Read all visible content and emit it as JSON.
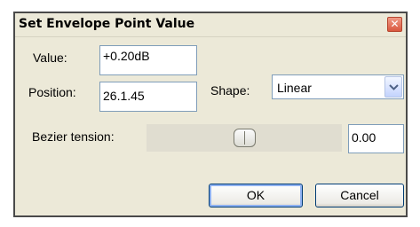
{
  "window": {
    "title": "Set Envelope Point Value",
    "close_glyph": "✕"
  },
  "fields": {
    "value_label": "Value:",
    "value": "+0.20dB",
    "position_label": "Position:",
    "position": "26.1.45",
    "shape_label": "Shape:",
    "shape_selected": "Linear",
    "bezier_label": "Bezier tension:",
    "bezier_value": "0.00",
    "bezier_slider_level": 0.5
  },
  "buttons": {
    "ok": "OK",
    "cancel": "Cancel"
  },
  "colors": {
    "dialog_bg": "#ece9d8",
    "close_button": "#d9583f",
    "input_border": "#7f9db9"
  },
  "icons": {
    "close": "close-icon",
    "dropdown": "chevron-down-icon",
    "slider_thumb": "slider-thumb"
  }
}
